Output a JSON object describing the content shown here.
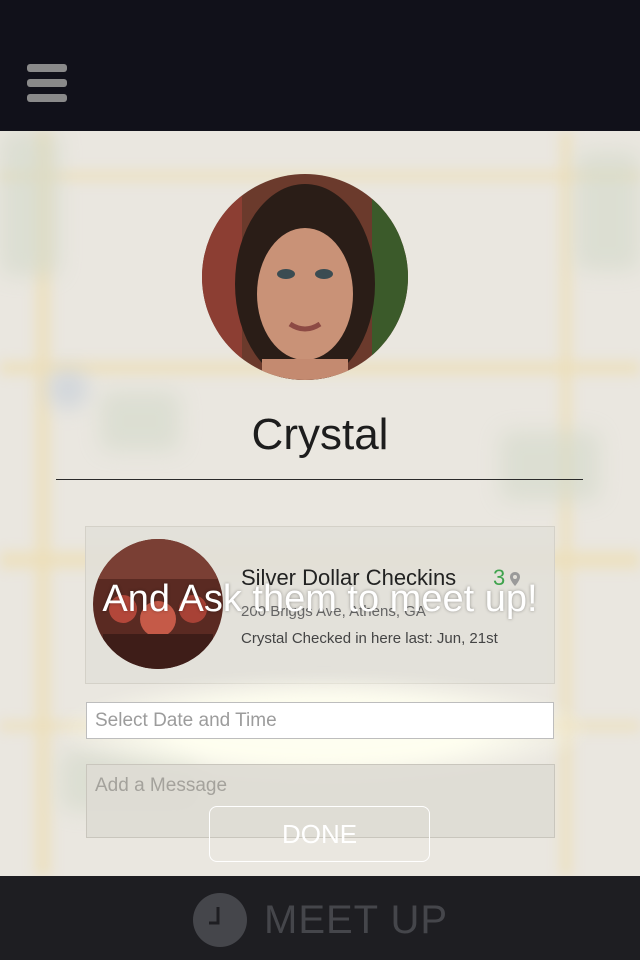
{
  "header": {
    "menu_icon": "hamburger-menu-icon"
  },
  "profile": {
    "name": "Crystal",
    "avatar_icon": "profile-photo"
  },
  "checkin": {
    "place_name": "Silver Dollar Checkins",
    "count": "3",
    "address": "200 Briggs Ave, Athens, GA",
    "last_checkin": "Crystal Checked in here last: Jun, 21st",
    "thumb_icon": "venue-photo"
  },
  "overlay": {
    "title": "And Ask them to meet up!"
  },
  "form": {
    "date_placeholder": "Select Date and Time",
    "message_placeholder": "Add a Message",
    "done_label": "DONE"
  },
  "footer": {
    "label": "MEET UP",
    "icon": "clock-icon"
  },
  "colors": {
    "header": "#11111a",
    "footer": "#1e1e22",
    "accent_green": "#3fa34d"
  }
}
